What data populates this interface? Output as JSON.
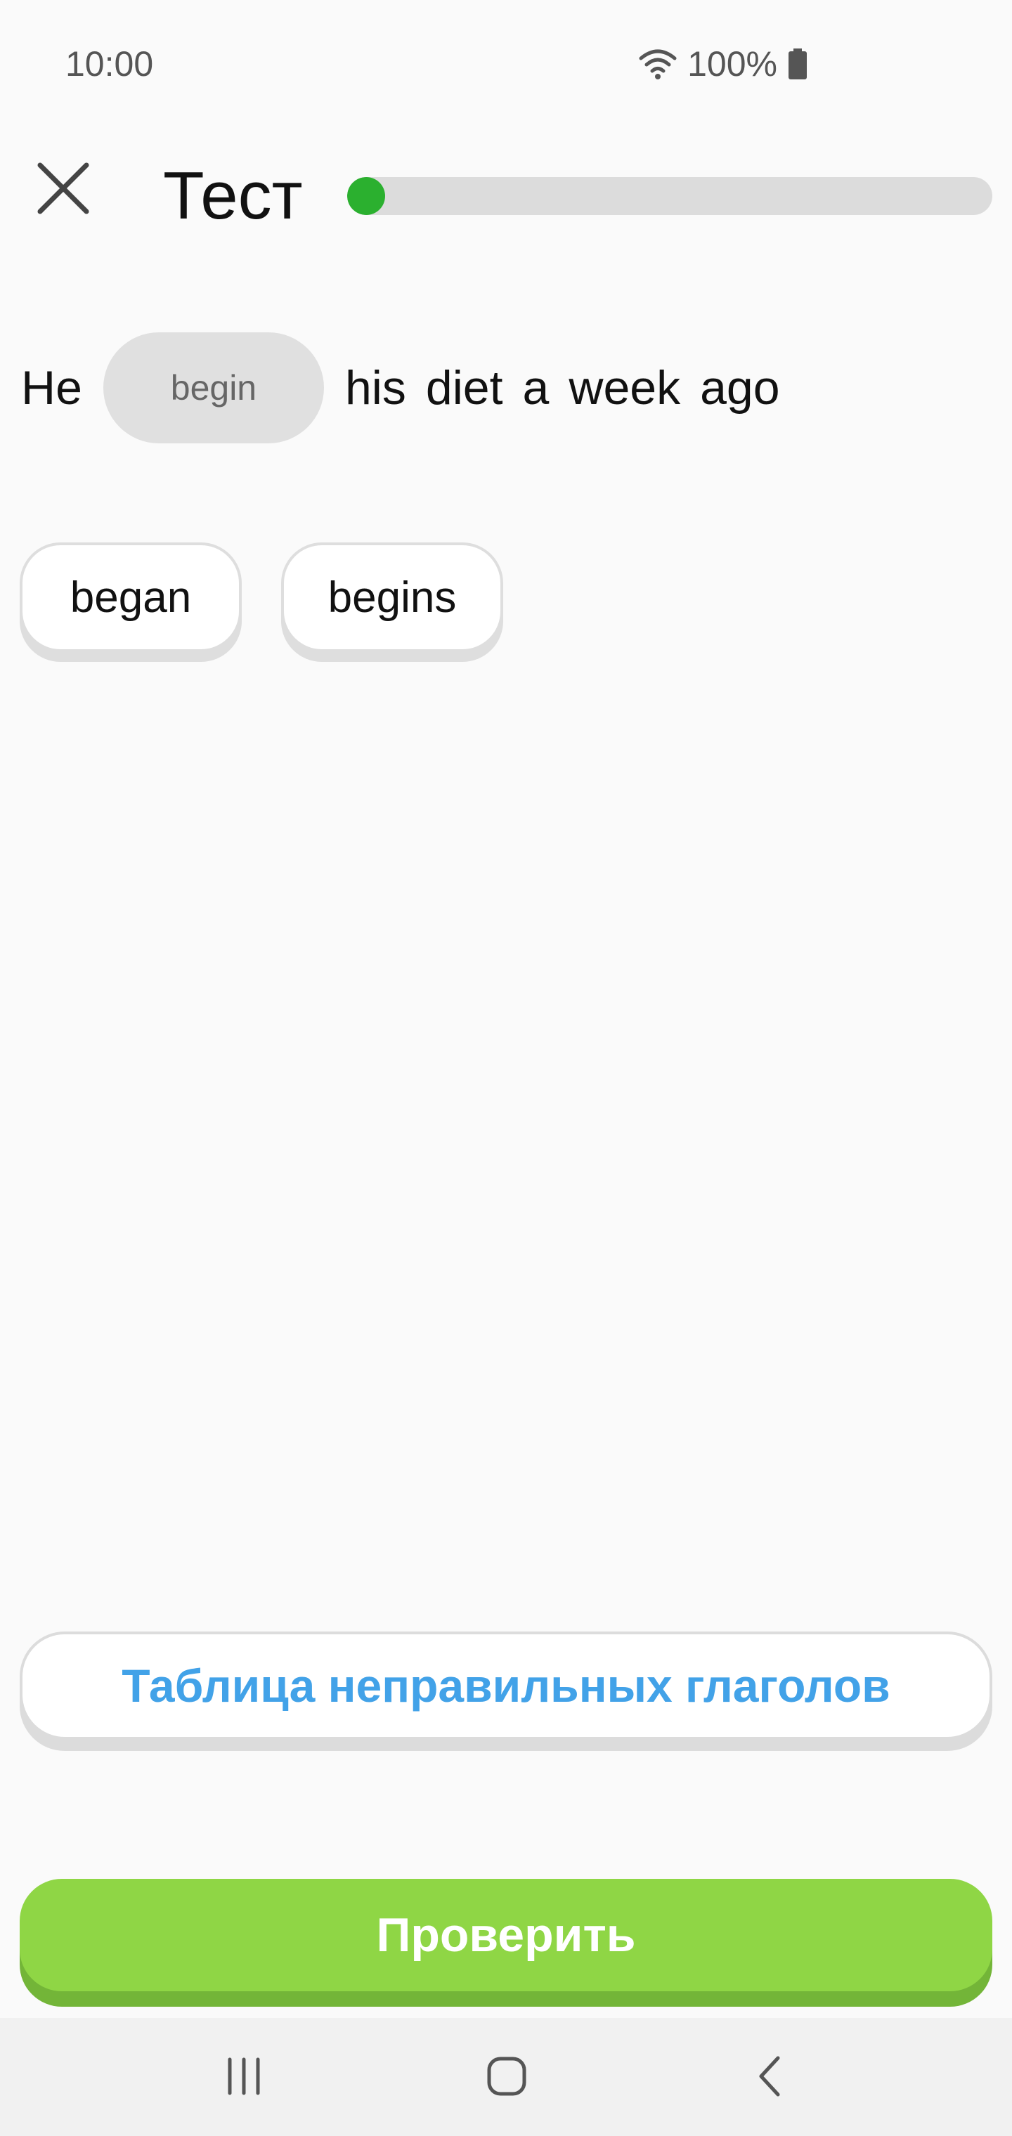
{
  "status_bar": {
    "time": "10:00",
    "battery_text": "100%",
    "icons": [
      "wifi-icon",
      "battery-icon"
    ]
  },
  "header": {
    "title": "Тест",
    "progress": 0.03,
    "progress_color": "#2bb02f"
  },
  "question": {
    "prefix": "He",
    "blank_hint": "begin",
    "suffix_words": [
      "his",
      "diet",
      "a",
      "week",
      "ago"
    ]
  },
  "choices": [
    "began",
    "begins"
  ],
  "table_button_label": "Таблица неправильных глаголов",
  "check_button_label": "Проверить",
  "colors": {
    "accent_green": "#8fd645",
    "link_blue": "#42a2e8"
  },
  "nav_bar": {
    "icons": [
      "recents-icon",
      "home-icon",
      "back-icon"
    ]
  }
}
